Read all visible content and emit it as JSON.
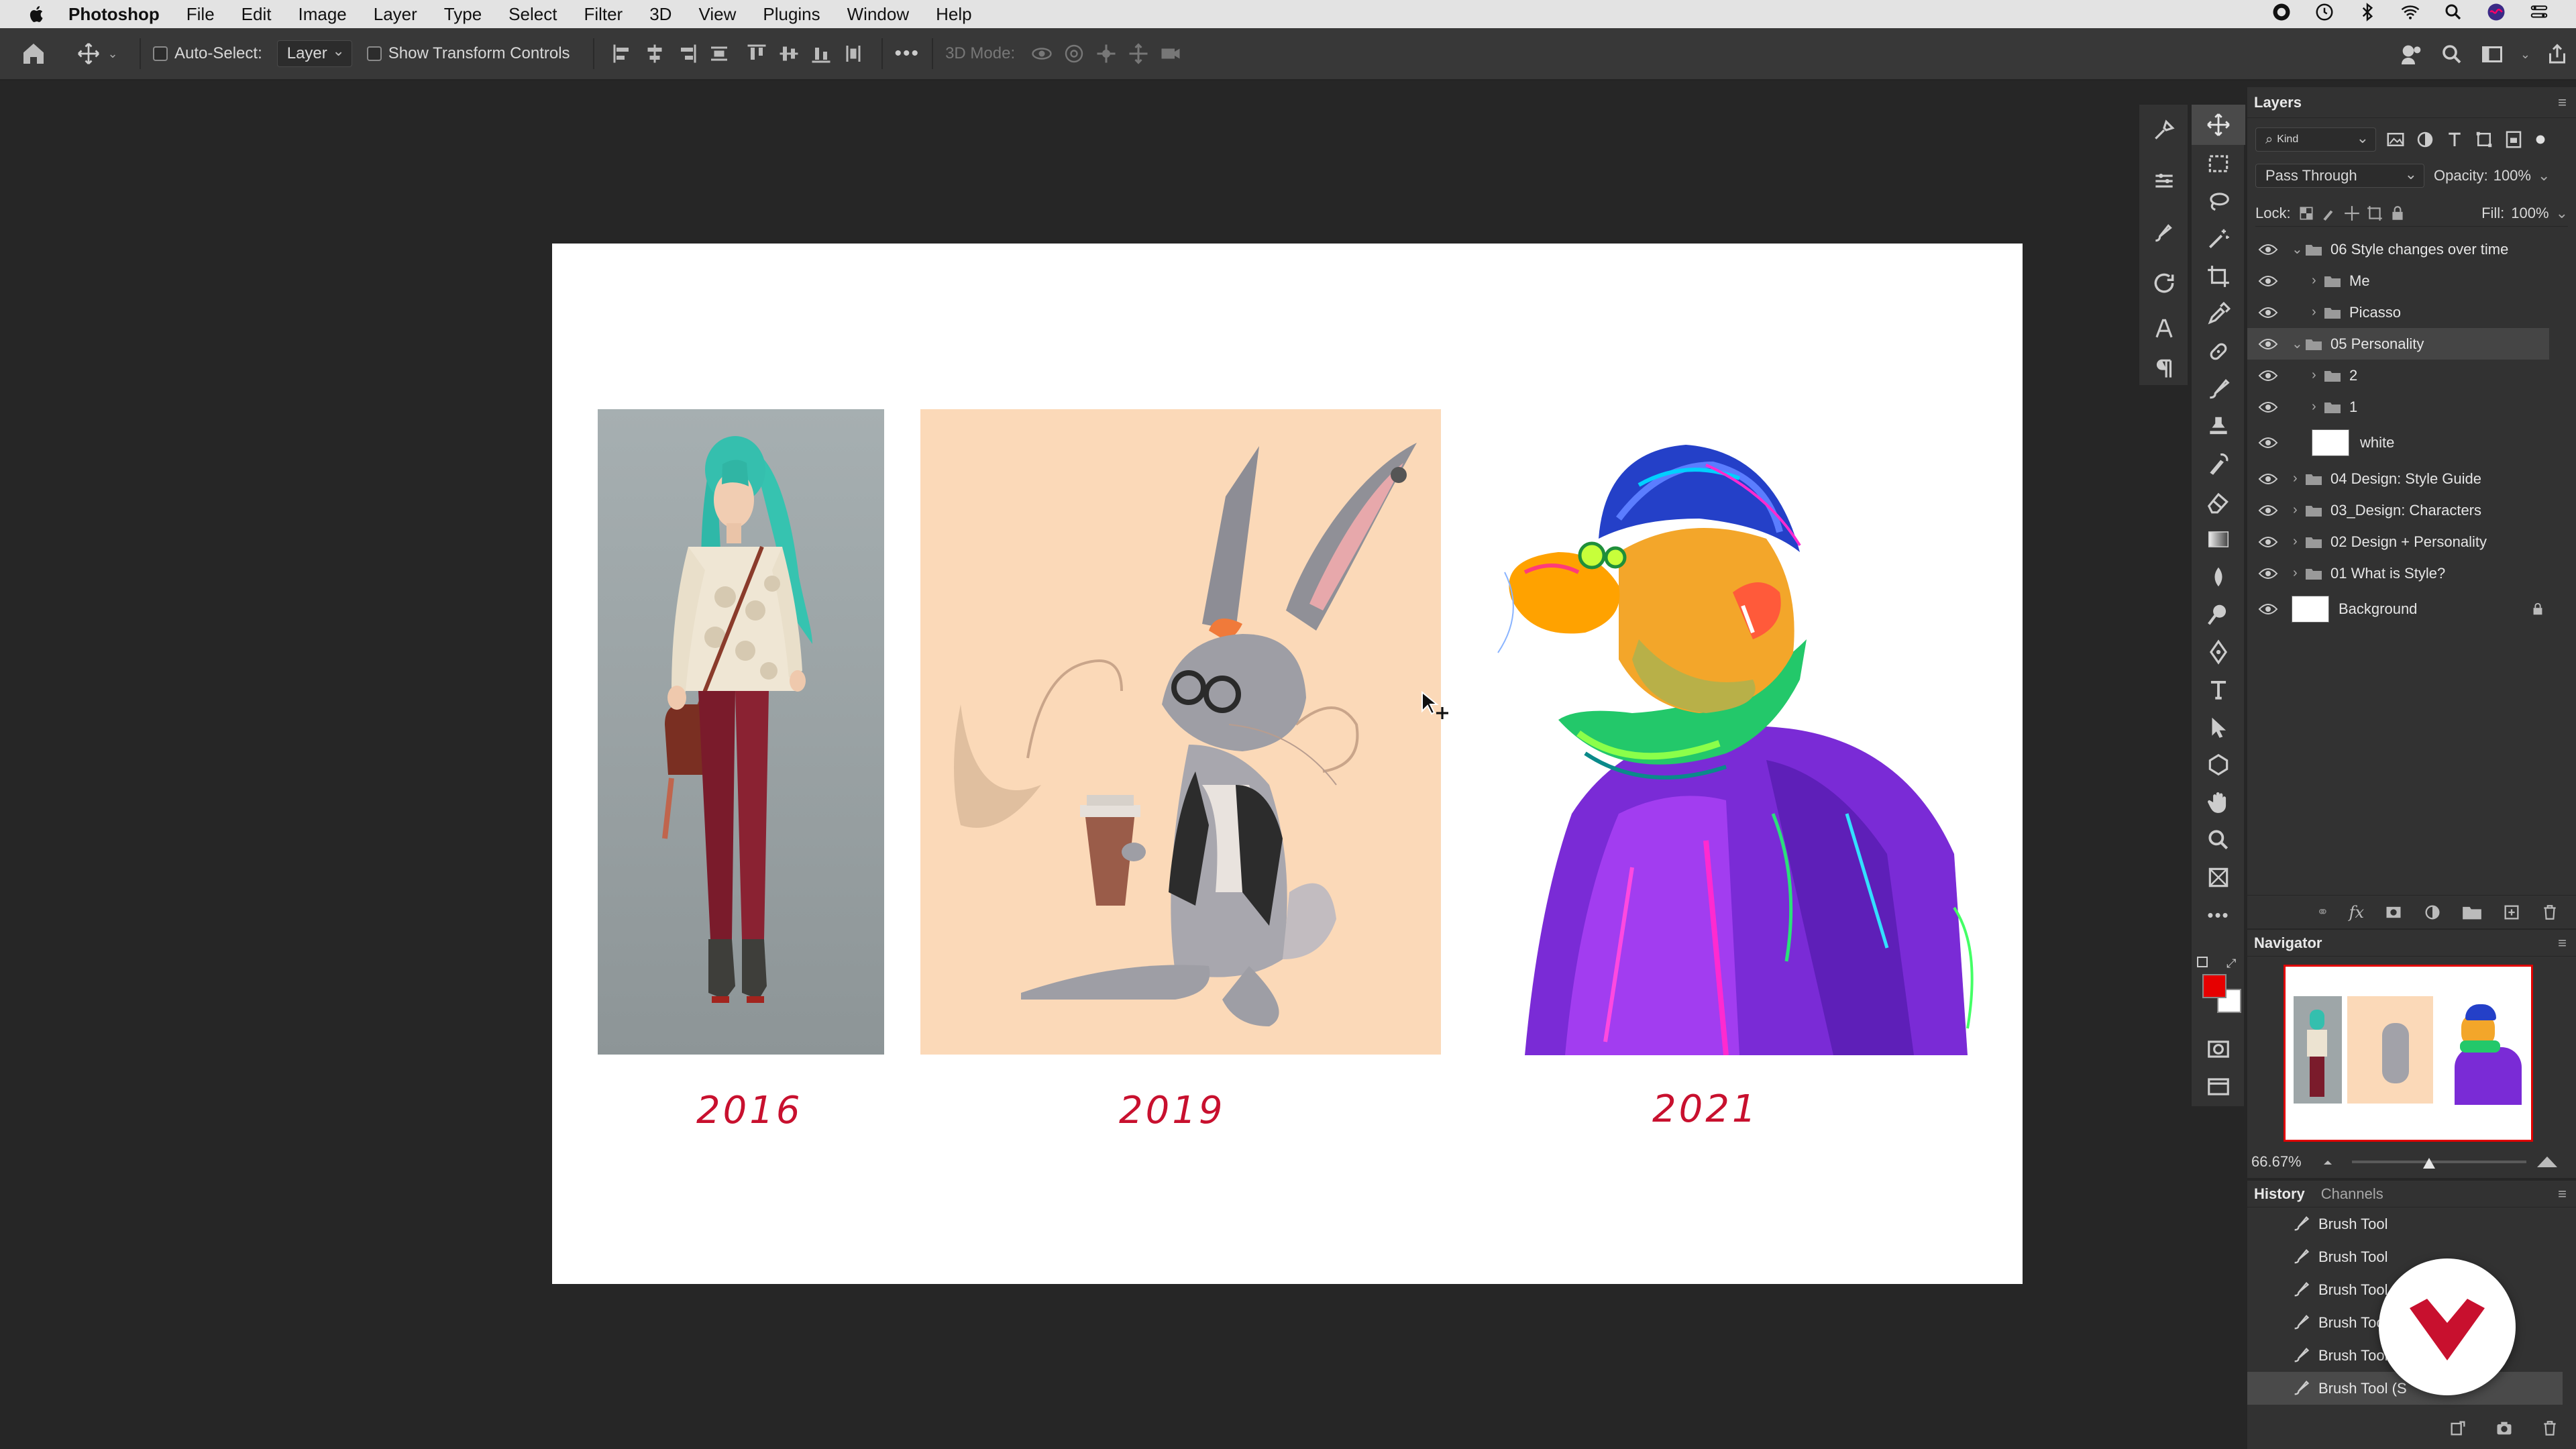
{
  "menubar": {
    "app_name": "Photoshop",
    "items": [
      "File",
      "Edit",
      "Image",
      "Layer",
      "Type",
      "Select",
      "Filter",
      "3D",
      "View",
      "Plugins",
      "Window",
      "Help"
    ],
    "status_icons": [
      "record-icon",
      "time-machine-icon",
      "bluetooth-icon",
      "wifi-icon",
      "spotlight-icon",
      "siri-icon",
      "control-center-icon"
    ]
  },
  "optionsbar": {
    "auto_select_label": "Auto-Select:",
    "auto_select_value": "Layer",
    "show_transform_label": "Show Transform Controls",
    "mode_3d_label": "3D Mode:"
  },
  "canvas": {
    "years": [
      "2016",
      "2019",
      "2021"
    ]
  },
  "layers_panel": {
    "title": "Layers",
    "filter_kind": "Kind",
    "blend_mode": "Pass Through",
    "opacity_label": "Opacity:",
    "opacity_value": "100%",
    "lock_label": "Lock:",
    "fill_label": "Fill:",
    "fill_value": "100%",
    "layers": [
      {
        "name": "06 Style changes over time",
        "type": "group",
        "expanded": true,
        "indent": 0
      },
      {
        "name": "Me",
        "type": "group",
        "expanded": false,
        "indent": 1
      },
      {
        "name": "Picasso",
        "type": "group",
        "expanded": false,
        "indent": 1
      },
      {
        "name": "05 Personality",
        "type": "group",
        "expanded": true,
        "indent": 0,
        "selected": true
      },
      {
        "name": "2",
        "type": "group",
        "expanded": false,
        "indent": 1
      },
      {
        "name": "1",
        "type": "group",
        "expanded": false,
        "indent": 1
      },
      {
        "name": "white",
        "type": "pixel",
        "indent": 1
      },
      {
        "name": "04 Design: Style Guide",
        "type": "group",
        "expanded": false,
        "indent": 0
      },
      {
        "name": "03_Design: Characters",
        "type": "group",
        "expanded": false,
        "indent": 0
      },
      {
        "name": "02 Design + Personality",
        "type": "group",
        "expanded": false,
        "indent": 0
      },
      {
        "name": "01 What is Style?",
        "type": "group",
        "expanded": false,
        "indent": 0
      },
      {
        "name": "Background",
        "type": "pixel",
        "locked": true,
        "indent": 0
      }
    ]
  },
  "navigator": {
    "title": "Navigator",
    "zoom": "66.67%"
  },
  "history_panel": {
    "tabs": [
      "History",
      "Channels"
    ],
    "items": [
      "Brush Tool",
      "Brush Tool",
      "Brush Tool",
      "Brush Tool",
      "Brush Tool",
      "Brush Tool (S"
    ]
  },
  "colors": {
    "foreground": "#e60000",
    "background": "#ffffff",
    "year_text": "#c8102e",
    "logo": "#c8102e"
  },
  "tools": [
    "move-tool-icon",
    "marquee-tool-icon",
    "lasso-tool-icon",
    "magic-wand-icon",
    "crop-tool-icon",
    "eyedropper-icon",
    "healing-brush-icon",
    "brush-tool-icon",
    "clone-stamp-icon",
    "history-brush-icon",
    "eraser-icon",
    "gradient-icon",
    "blur-icon",
    "dodge-icon",
    "pen-tool-icon",
    "type-tool-icon",
    "path-selection-icon",
    "shape-tool-icon",
    "hand-tool-icon",
    "zoom-tool-icon",
    "frame-tool-icon",
    "more-tools-icon"
  ]
}
